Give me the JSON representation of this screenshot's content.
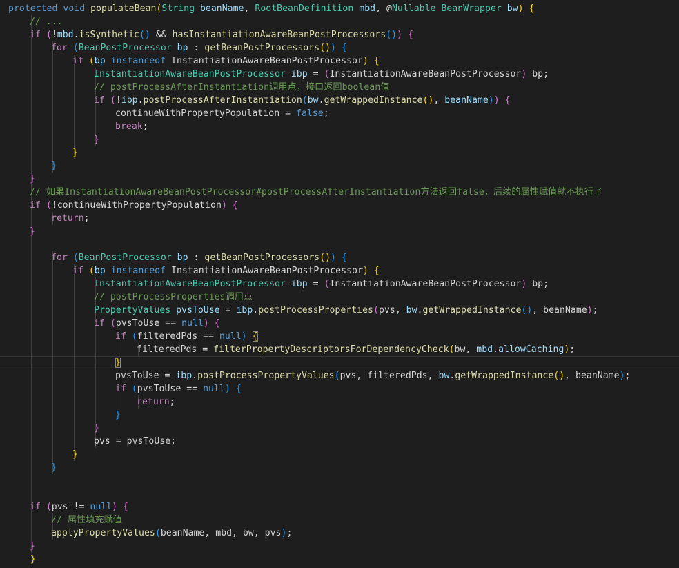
{
  "editor": {
    "language": "java",
    "colors": {
      "background": "#1e1e1e",
      "keyword": "#569cd6",
      "control": "#c586c0",
      "type": "#4ec9b0",
      "function": "#dcdcaa",
      "variable": "#9cdcfe",
      "comment": "#6a9955",
      "plain": "#d4d4d4",
      "bracket_level_1": "#ffd700",
      "bracket_level_2": "#da70d6",
      "bracket_level_3": "#179fff"
    },
    "current_line": 27,
    "bracket_match_lines": [
      26,
      28
    ],
    "lines": [
      {
        "indent": 0,
        "tokens": [
          [
            "kw",
            "protected"
          ],
          [
            "plain",
            " "
          ],
          [
            "kw",
            "void"
          ],
          [
            "plain",
            " "
          ],
          [
            "fn",
            "populateBean"
          ],
          [
            "b1",
            "("
          ],
          [
            "type",
            "String"
          ],
          [
            "plain",
            " "
          ],
          [
            "var",
            "beanName"
          ],
          [
            "plain",
            ", "
          ],
          [
            "type",
            "RootBeanDefinition"
          ],
          [
            "plain",
            " "
          ],
          [
            "var",
            "mbd"
          ],
          [
            "plain",
            ", "
          ],
          [
            "plain",
            "@"
          ],
          [
            "type",
            "Nullable"
          ],
          [
            "plain",
            " "
          ],
          [
            "type",
            "BeanWrapper"
          ],
          [
            "plain",
            " "
          ],
          [
            "var",
            "bw"
          ],
          [
            "b1",
            ")"
          ],
          [
            "plain",
            " "
          ],
          [
            "b1",
            "{"
          ]
        ]
      },
      {
        "indent": 1,
        "tokens": [
          [
            "com",
            "// ..."
          ]
        ]
      },
      {
        "indent": 1,
        "tokens": [
          [
            "ctl",
            "if"
          ],
          [
            "plain",
            " "
          ],
          [
            "b2",
            "("
          ],
          [
            "plain",
            "!"
          ],
          [
            "var",
            "mbd"
          ],
          [
            "plain",
            "."
          ],
          [
            "fn",
            "isSynthetic"
          ],
          [
            "b3",
            "()"
          ],
          [
            "plain",
            " && "
          ],
          [
            "fn",
            "hasInstantiationAwareBeanPostProcessors"
          ],
          [
            "b3",
            "()"
          ],
          [
            "b2",
            ")"
          ],
          [
            "plain",
            " "
          ],
          [
            "b2",
            "{"
          ]
        ]
      },
      {
        "indent": 2,
        "tokens": [
          [
            "ctl",
            "for"
          ],
          [
            "plain",
            " "
          ],
          [
            "b3",
            "("
          ],
          [
            "type",
            "BeanPostProcessor"
          ],
          [
            "plain",
            " "
          ],
          [
            "var",
            "bp"
          ],
          [
            "plain",
            " : "
          ],
          [
            "fn",
            "getBeanPostProcessors"
          ],
          [
            "b1",
            "()"
          ],
          [
            "b3",
            ")"
          ],
          [
            "plain",
            " "
          ],
          [
            "b3",
            "{"
          ]
        ]
      },
      {
        "indent": 3,
        "tokens": [
          [
            "ctl",
            "if"
          ],
          [
            "plain",
            " "
          ],
          [
            "b1",
            "("
          ],
          [
            "var",
            "bp"
          ],
          [
            "plain",
            " "
          ],
          [
            "kw",
            "instanceof"
          ],
          [
            "plain",
            " "
          ],
          [
            "plain",
            "InstantiationAwareBeanPostProcessor"
          ],
          [
            "b1",
            ")"
          ],
          [
            "plain",
            " "
          ],
          [
            "b1",
            "{"
          ]
        ]
      },
      {
        "indent": 4,
        "tokens": [
          [
            "type",
            "InstantiationAwareBeanPostProcessor"
          ],
          [
            "plain",
            " "
          ],
          [
            "var",
            "ibp"
          ],
          [
            "plain",
            " = "
          ],
          [
            "b2",
            "("
          ],
          [
            "plain",
            "InstantiationAwareBeanPostProcessor"
          ],
          [
            "b2",
            ")"
          ],
          [
            "plain",
            " bp;"
          ]
        ]
      },
      {
        "indent": 4,
        "tokens": [
          [
            "com",
            "// postProcessAfterInstantiation调用点，接口返回boolean值"
          ]
        ]
      },
      {
        "indent": 4,
        "tokens": [
          [
            "ctl",
            "if"
          ],
          [
            "plain",
            " "
          ],
          [
            "b2",
            "("
          ],
          [
            "plain",
            "!"
          ],
          [
            "var",
            "ibp"
          ],
          [
            "plain",
            "."
          ],
          [
            "fn",
            "postProcessAfterInstantiation"
          ],
          [
            "b3",
            "("
          ],
          [
            "var",
            "bw"
          ],
          [
            "plain",
            "."
          ],
          [
            "fn",
            "getWrappedInstance"
          ],
          [
            "b1",
            "()"
          ],
          [
            "plain",
            ", "
          ],
          [
            "var",
            "beanName"
          ],
          [
            "b3",
            ")"
          ],
          [
            "b2",
            ")"
          ],
          [
            "plain",
            " "
          ],
          [
            "b2",
            "{"
          ]
        ]
      },
      {
        "indent": 5,
        "tokens": [
          [
            "plain",
            "continueWithPropertyPopulation = "
          ],
          [
            "kw",
            "false"
          ],
          [
            "plain",
            ";"
          ]
        ]
      },
      {
        "indent": 5,
        "tokens": [
          [
            "ctl",
            "break"
          ],
          [
            "plain",
            ";"
          ]
        ]
      },
      {
        "indent": 4,
        "tokens": [
          [
            "b2",
            "}"
          ]
        ]
      },
      {
        "indent": 3,
        "tokens": [
          [
            "b1",
            "}"
          ]
        ]
      },
      {
        "indent": 2,
        "tokens": [
          [
            "b3",
            "}"
          ]
        ]
      },
      {
        "indent": 1,
        "tokens": [
          [
            "b2",
            "}"
          ]
        ]
      },
      {
        "indent": 1,
        "tokens": [
          [
            "com",
            "// 如果InstantiationAwareBeanPostProcessor#postProcessAfterInstantiation方法返回false，后续的属性赋值就不执行了"
          ]
        ]
      },
      {
        "indent": 1,
        "tokens": [
          [
            "ctl",
            "if"
          ],
          [
            "plain",
            " "
          ],
          [
            "b2",
            "("
          ],
          [
            "plain",
            "!continueWithPropertyPopulation"
          ],
          [
            "b2",
            ")"
          ],
          [
            "plain",
            " "
          ],
          [
            "b2",
            "{"
          ]
        ]
      },
      {
        "indent": 2,
        "tokens": [
          [
            "ctl",
            "return"
          ],
          [
            "plain",
            ";"
          ]
        ]
      },
      {
        "indent": 1,
        "tokens": [
          [
            "b2",
            "}"
          ]
        ]
      },
      {
        "indent": 0,
        "tokens": []
      },
      {
        "indent": 2,
        "tokens": [
          [
            "ctl",
            "for"
          ],
          [
            "plain",
            " "
          ],
          [
            "b3",
            "("
          ],
          [
            "type",
            "BeanPostProcessor"
          ],
          [
            "plain",
            " "
          ],
          [
            "var",
            "bp"
          ],
          [
            "plain",
            " : "
          ],
          [
            "fn",
            "getBeanPostProcessors"
          ],
          [
            "b1",
            "()"
          ],
          [
            "b3",
            ")"
          ],
          [
            "plain",
            " "
          ],
          [
            "b3",
            "{"
          ]
        ]
      },
      {
        "indent": 3,
        "tokens": [
          [
            "ctl",
            "if"
          ],
          [
            "plain",
            " "
          ],
          [
            "b1",
            "("
          ],
          [
            "var",
            "bp"
          ],
          [
            "plain",
            " "
          ],
          [
            "kw",
            "instanceof"
          ],
          [
            "plain",
            " "
          ],
          [
            "plain",
            "InstantiationAwareBeanPostProcessor"
          ],
          [
            "b1",
            ")"
          ],
          [
            "plain",
            " "
          ],
          [
            "b1",
            "{"
          ]
        ]
      },
      {
        "indent": 4,
        "tokens": [
          [
            "type",
            "InstantiationAwareBeanPostProcessor"
          ],
          [
            "plain",
            " "
          ],
          [
            "var",
            "ibp"
          ],
          [
            "plain",
            " = "
          ],
          [
            "b2",
            "("
          ],
          [
            "plain",
            "InstantiationAwareBeanPostProcessor"
          ],
          [
            "b2",
            ")"
          ],
          [
            "plain",
            " bp;"
          ]
        ]
      },
      {
        "indent": 4,
        "tokens": [
          [
            "com",
            "// postProcessProperties调用点"
          ]
        ]
      },
      {
        "indent": 4,
        "tokens": [
          [
            "type",
            "PropertyValues"
          ],
          [
            "plain",
            " "
          ],
          [
            "var",
            "pvsToUse"
          ],
          [
            "plain",
            " = "
          ],
          [
            "var",
            "ibp"
          ],
          [
            "plain",
            "."
          ],
          [
            "fn",
            "postProcessProperties"
          ],
          [
            "b2",
            "("
          ],
          [
            "plain",
            "pvs, "
          ],
          [
            "var",
            "bw"
          ],
          [
            "plain",
            "."
          ],
          [
            "fn",
            "getWrappedInstance"
          ],
          [
            "b3",
            "()"
          ],
          [
            "plain",
            ", beanName"
          ],
          [
            "b2",
            ")"
          ],
          [
            "plain",
            ";"
          ]
        ]
      },
      {
        "indent": 4,
        "tokens": [
          [
            "ctl",
            "if"
          ],
          [
            "plain",
            " "
          ],
          [
            "b2",
            "("
          ],
          [
            "plain",
            "pvsToUse == "
          ],
          [
            "kw",
            "null"
          ],
          [
            "b2",
            ")"
          ],
          [
            "plain",
            " "
          ],
          [
            "b2",
            "{"
          ]
        ]
      },
      {
        "indent": 5,
        "tokens": [
          [
            "ctl",
            "if"
          ],
          [
            "plain",
            " "
          ],
          [
            "b3",
            "("
          ],
          [
            "plain",
            "filteredPds == "
          ],
          [
            "kw",
            "null"
          ],
          [
            "b3",
            ")"
          ],
          [
            "plain",
            " "
          ],
          [
            "match",
            "{"
          ]
        ]
      },
      {
        "indent": 6,
        "tokens": [
          [
            "plain",
            "filteredPds = "
          ],
          [
            "fn",
            "filterPropertyDescriptorsForDependencyCheck"
          ],
          [
            "b1",
            "("
          ],
          [
            "plain",
            "bw, "
          ],
          [
            "var",
            "mbd"
          ],
          [
            "plain",
            "."
          ],
          [
            "var",
            "allowCaching"
          ],
          [
            "b1",
            ")"
          ],
          [
            "plain",
            ";"
          ]
        ]
      },
      {
        "indent": 5,
        "tokens": [
          [
            "match",
            "}"
          ]
        ]
      },
      {
        "indent": 5,
        "tokens": [
          [
            "plain",
            "pvsToUse = "
          ],
          [
            "var",
            "ibp"
          ],
          [
            "plain",
            "."
          ],
          [
            "fn",
            "postProcessPropertyValues"
          ],
          [
            "b3",
            "("
          ],
          [
            "plain",
            "pvs, filteredPds, "
          ],
          [
            "var",
            "bw"
          ],
          [
            "plain",
            "."
          ],
          [
            "fn",
            "getWrappedInstance"
          ],
          [
            "b1",
            "()"
          ],
          [
            "plain",
            ", beanName"
          ],
          [
            "b3",
            ")"
          ],
          [
            "plain",
            ";"
          ]
        ]
      },
      {
        "indent": 5,
        "tokens": [
          [
            "ctl",
            "if"
          ],
          [
            "plain",
            " "
          ],
          [
            "b3",
            "("
          ],
          [
            "plain",
            "pvsToUse == "
          ],
          [
            "kw",
            "null"
          ],
          [
            "b3",
            ")"
          ],
          [
            "plain",
            " "
          ],
          [
            "b3",
            "{"
          ]
        ]
      },
      {
        "indent": 6,
        "tokens": [
          [
            "ctl",
            "return"
          ],
          [
            "plain",
            ";"
          ]
        ]
      },
      {
        "indent": 5,
        "tokens": [
          [
            "b3",
            "}"
          ]
        ]
      },
      {
        "indent": 4,
        "tokens": [
          [
            "b2",
            "}"
          ]
        ]
      },
      {
        "indent": 4,
        "tokens": [
          [
            "plain",
            "pvs = pvsToUse;"
          ]
        ]
      },
      {
        "indent": 3,
        "tokens": [
          [
            "b1",
            "}"
          ]
        ]
      },
      {
        "indent": 2,
        "tokens": [
          [
            "b3",
            "}"
          ]
        ]
      },
      {
        "indent": 0,
        "tokens": []
      },
      {
        "indent": 0,
        "tokens": []
      },
      {
        "indent": 1,
        "tokens": [
          [
            "ctl",
            "if"
          ],
          [
            "plain",
            " "
          ],
          [
            "b2",
            "("
          ],
          [
            "plain",
            "pvs != "
          ],
          [
            "kw",
            "null"
          ],
          [
            "b2",
            ")"
          ],
          [
            "plain",
            " "
          ],
          [
            "b2",
            "{"
          ]
        ]
      },
      {
        "indent": 2,
        "tokens": [
          [
            "com",
            "// 属性填充赋值"
          ]
        ]
      },
      {
        "indent": 2,
        "tokens": [
          [
            "fn",
            "applyPropertyValues"
          ],
          [
            "b3",
            "("
          ],
          [
            "plain",
            "beanName, mbd, bw, pvs"
          ],
          [
            "b3",
            ")"
          ],
          [
            "plain",
            ";"
          ]
        ]
      },
      {
        "indent": 1,
        "tokens": [
          [
            "b2",
            "}"
          ]
        ]
      },
      {
        "indent": 0,
        "tokens": [
          [
            "plain",
            "    "
          ],
          [
            "b1",
            "}"
          ]
        ]
      }
    ]
  }
}
